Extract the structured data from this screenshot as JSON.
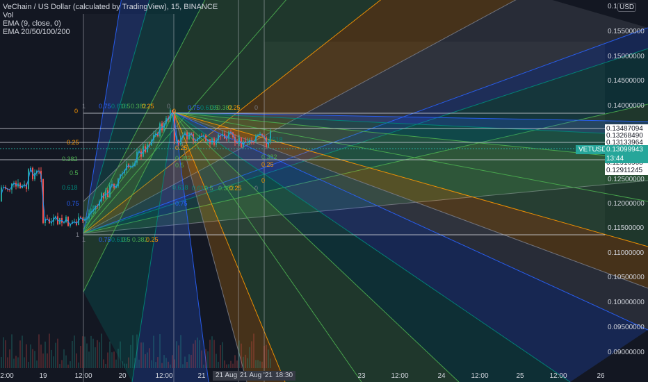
{
  "legend": {
    "title": "VeChain / US Dollar (calculated by TradingView), 15, BINANCE",
    "vol": "Vol",
    "ema_single": "EMA (9, close, 0)",
    "ema_multi": "EMA 20/50/100/200"
  },
  "currency_badge": "USD",
  "symbol_tag": "VETUSD",
  "last_price": {
    "value": "0.13099943",
    "countdown": "13:44"
  },
  "price_axis": [
    "0.1",
    "0.15500000",
    "0.15000000",
    "0.14500000",
    "0.14000000",
    "0.12500000",
    "0.12000000",
    "0.11500000",
    "0.11000000",
    "0.10500000",
    "0.10000000",
    "0.09500000",
    "0.09000000"
  ],
  "price_tags": [
    "0.13487094",
    "0.13268490",
    "0.13133964",
    "0.12916908",
    "0.12911245"
  ],
  "time_axis": [
    "2:00",
    "19",
    "12:00",
    "20",
    "12:00",
    "21",
    "12:00",
    "23",
    "12:00",
    "24",
    "12:00",
    "25",
    "12:00",
    "26"
  ],
  "time_highlights": [
    "21 Aug",
    "21 Aug '21",
    "18:30"
  ],
  "fib_levels": {
    "fan_top_row": [
      "1",
      "0.75",
      "0.618",
      "0.5",
      "0.382",
      "0.25",
      "0"
    ],
    "fan_left_col": [
      "0",
      "0.25",
      "0.382",
      "0.5",
      "0.618",
      "0.75",
      "1"
    ],
    "fan_bottom_row": [
      "1",
      "0.75",
      "0.618",
      "0.5",
      "0.382",
      "0.25"
    ],
    "fan2_top_row": [
      "0.75",
      "0.618",
      "0.5",
      "0.382",
      "0.25",
      "0"
    ],
    "fan2_left_col": [
      "0",
      "0.25",
      "0.382",
      "0.5",
      "0.618",
      "0.75"
    ],
    "fan2_bottom_row": [
      "0.618",
      "0.5",
      "0.382",
      "0.25",
      "0"
    ],
    "fan3_right_col": [
      "0.618",
      "0.382",
      "0.25",
      "0"
    ]
  },
  "colors": {
    "background": "#131722",
    "fib_blue": "#2962ff",
    "fib_teal": "#00897b",
    "fib_green": "#4caf50",
    "fib_orange": "#ff9800",
    "fib_gray": "#787b86",
    "candle_up": "#26a69a",
    "candle_down": "#ef5350",
    "ema": "#2196f3"
  }
}
